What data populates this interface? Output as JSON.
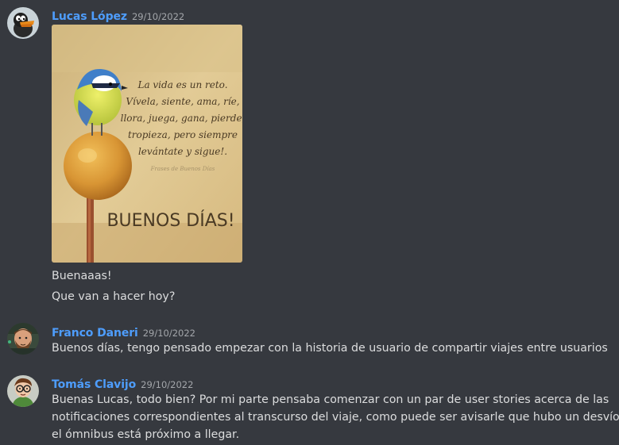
{
  "messages": [
    {
      "author": "Lucas López",
      "timestamp": "29/10/2022",
      "avatar_icon": "duck-cartoon-avatar",
      "attachment": {
        "quote_lines": [
          "La vida es un reto.",
          "Vívela, siente, ama, ríe,",
          "llora, juega, gana, pierde,",
          "tropieza, pero siempre",
          "levántate y sigue!."
        ],
        "watermark": "Frases de Buenos Días",
        "headline": "BUENOS DÍAS!"
      },
      "lines": [
        "Buenaaas!",
        "Que van a hacer hoy?"
      ]
    },
    {
      "author": "Franco Daneri",
      "timestamp": "29/10/2022",
      "avatar_icon": "bearded-man-avatar",
      "lines": [
        "Buenos días, tengo pensado empezar con la historia de usuario de compartir viajes entre usuarios"
      ]
    },
    {
      "author": "Tomás Clavijo",
      "timestamp": "29/10/2022",
      "avatar_icon": "glasses-cartoon-avatar",
      "lines": [
        "Buenas Lucas, todo bien? Por mi parte pensaba comenzar con un par de user stories acerca de las",
        "notificaciones correspondientes al transcurso del viaje, como puede ser avisarle que hubo un desvío o",
        "el ómnibus está próximo a llegar."
      ]
    }
  ],
  "colors": {
    "background": "#36393f",
    "username": "#4e9dfc",
    "text": "#dcddde",
    "timestamp": "#a3a6aa"
  }
}
